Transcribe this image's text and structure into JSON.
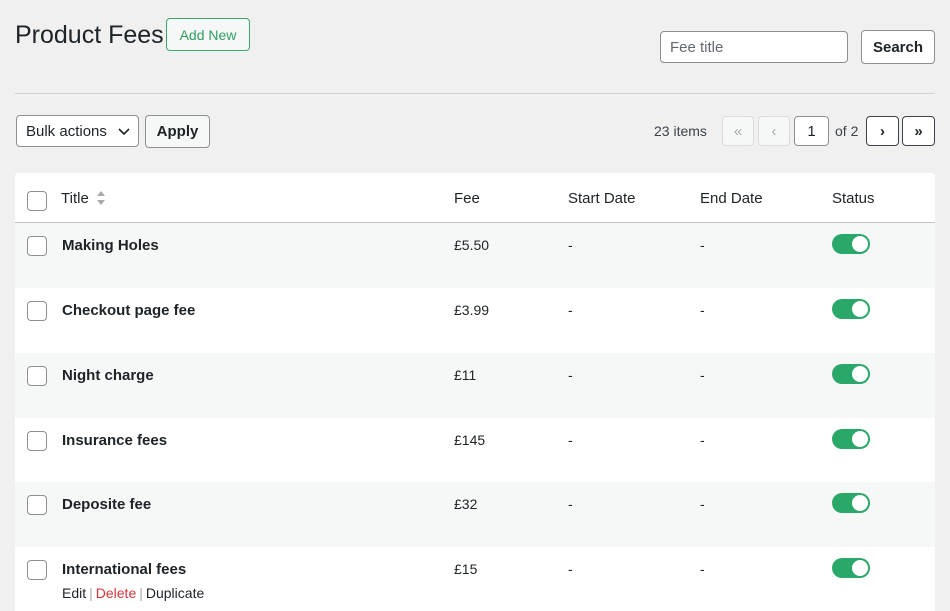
{
  "header": {
    "title": "Product Fees",
    "add_new_label": "Add New",
    "search_placeholder": "Fee title",
    "search_label": "Search"
  },
  "tablenav": {
    "bulk_actions_label": "Bulk actions",
    "apply_label": "Apply",
    "items_count": "23 items",
    "first_page": "«",
    "prev_page": "‹",
    "current_page": "1",
    "of_pages": "of 2",
    "next_page": "›",
    "last_page": "»"
  },
  "table": {
    "columns": {
      "title": "Title",
      "fee": "Fee",
      "start_date": "Start Date",
      "end_date": "End Date",
      "status": "Status"
    },
    "rows": [
      {
        "title": "Making Holes",
        "fee": "£5.50",
        "start": "-",
        "end": "-",
        "status": "on"
      },
      {
        "title": "Checkout page fee",
        "fee": "£3.99",
        "start": "-",
        "end": "-",
        "status": "on"
      },
      {
        "title": "Night charge",
        "fee": "£11",
        "start": "-",
        "end": "-",
        "status": "on"
      },
      {
        "title": "Insurance fees",
        "fee": "£145",
        "start": "-",
        "end": "-",
        "status": "on"
      },
      {
        "title": "Deposite fee",
        "fee": "£32",
        "start": "-",
        "end": "-",
        "status": "on"
      },
      {
        "title": "International fees",
        "fee": "£15",
        "start": "-",
        "end": "-",
        "status": "on"
      }
    ],
    "row_actions": {
      "edit": "Edit",
      "delete": "Delete",
      "duplicate": "Duplicate",
      "separator": "|"
    }
  },
  "colors": {
    "accent_green": "#2aa86a",
    "delete_red": "#d63638"
  }
}
